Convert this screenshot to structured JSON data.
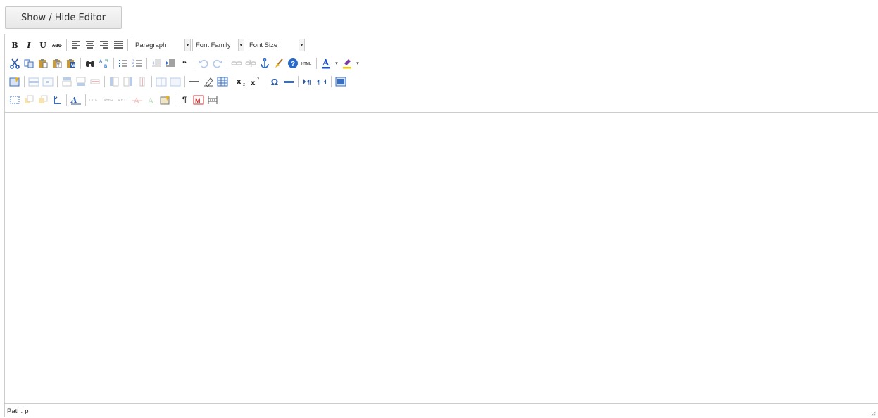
{
  "toggle_button": {
    "label": "Show / Hide Editor"
  },
  "toolbar": {
    "format_select": "Paragraph",
    "font_family_select": "Font Family",
    "font_size_select": "Font Size"
  },
  "statusbar": {
    "path_label": "Path:",
    "path_value": "p"
  },
  "colors": {
    "border": "#cccccc",
    "font_color_bar": "#1a4fd0",
    "highlight_bar": "#f2c800",
    "accent_blue": "#2a6ac8"
  }
}
